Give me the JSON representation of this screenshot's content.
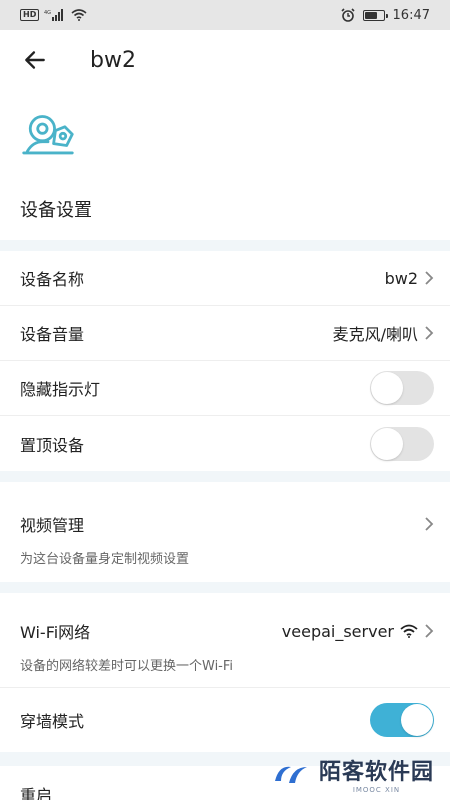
{
  "status_bar": {
    "hd": "HD",
    "network": "4G",
    "time": "16:47",
    "battery_level": 0.7
  },
  "appbar": {
    "title": "bw2"
  },
  "hero": {
    "section_title": "设备设置"
  },
  "settings": {
    "device_name_label": "设备名称",
    "device_name_value": "bw2",
    "volume_label": "设备音量",
    "volume_value": "麦克风/喇叭",
    "hide_light_label": "隐藏指示灯",
    "hide_light_on": false,
    "pin_device_label": "置顶设备",
    "pin_device_on": false
  },
  "video": {
    "label": "视频管理",
    "desc": "为这台设备量身定制视频设置"
  },
  "wifi": {
    "label": "Wi-Fi网络",
    "value": "veepai_server",
    "desc": "设备的网络较差时可以更换一个Wi-Fi"
  },
  "wall_mode": {
    "label": "穿墙模式",
    "on": true
  },
  "reboot": {
    "label": "重启"
  },
  "watermark": {
    "text": "陌客软件园",
    "sub": "IMOOC XIN"
  },
  "colors": {
    "accent": "#3fb1d6",
    "icon": "#4ab3c9",
    "section_bg": "#f1f6f9"
  }
}
